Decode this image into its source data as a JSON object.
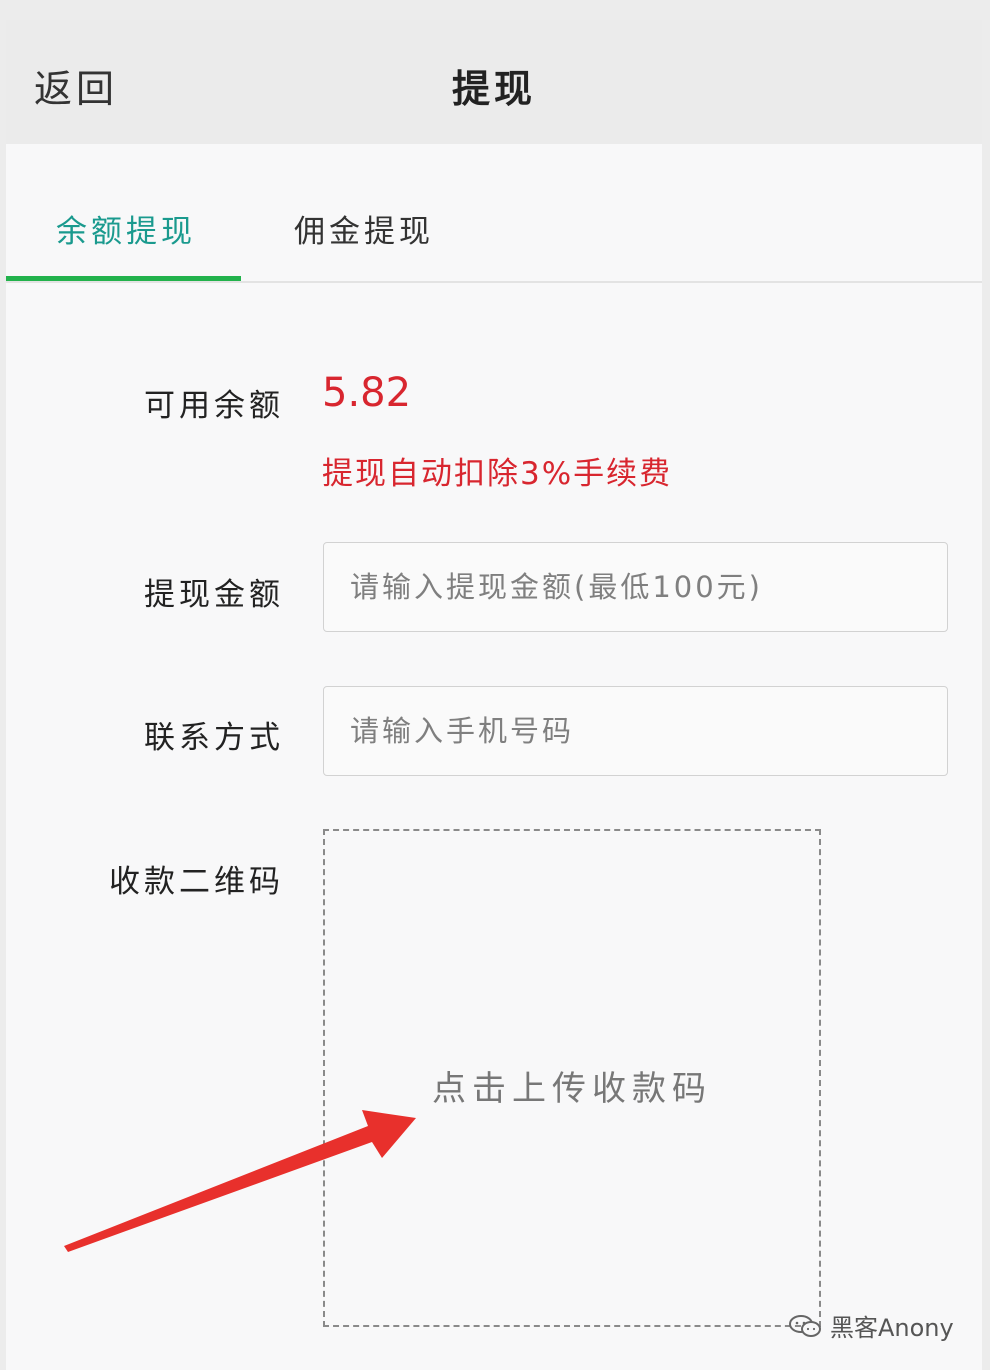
{
  "header": {
    "back_label": "返回",
    "title": "提现"
  },
  "tabs": [
    {
      "label": "余额提现",
      "active": true
    },
    {
      "label": "佣金提现",
      "active": false
    }
  ],
  "form": {
    "balance_label": "可用余额",
    "balance_value": "5.82",
    "fee_notice": "提现自动扣除3%手续费",
    "amount_label": "提现金额",
    "amount_placeholder": "请输入提现金额(最低100元)",
    "contact_label": "联系方式",
    "contact_placeholder": "请输入手机号码",
    "qrcode_label": "收款二维码",
    "upload_text": "点击上传收款码"
  },
  "watermark": {
    "text": "黑客Anony",
    "icon": "wechat-icon"
  },
  "colors": {
    "accent_tab": "#1a9a8e",
    "tab_underline": "#22b24c",
    "warning": "#d8262f",
    "arrow": "#e8302c"
  }
}
